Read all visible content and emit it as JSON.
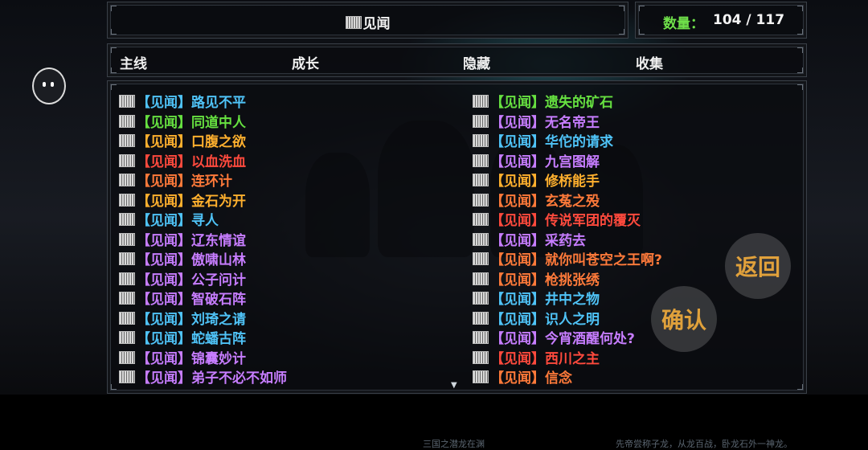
{
  "header": {
    "title": "见闻",
    "count_label": "数量：",
    "count_value": "104 / 117"
  },
  "tabs": [
    {
      "label": "主线"
    },
    {
      "label": "成长"
    },
    {
      "label": "隐藏"
    },
    {
      "label": "收集"
    }
  ],
  "left_column": [
    {
      "tag": "【见闻】",
      "name": "路见不平",
      "color": "#4fc3f7"
    },
    {
      "tag": "【见闻】",
      "name": "同道中人",
      "color": "#66e040"
    },
    {
      "tag": "【见闻】",
      "name": "口腹之欲",
      "color": "#ffb02e"
    },
    {
      "tag": "【见闻】",
      "name": "以血洗血",
      "color": "#ff4a3d"
    },
    {
      "tag": "【见闻】",
      "name": "连环计",
      "color": "#ff7a3a"
    },
    {
      "tag": "【见闻】",
      "name": "金石为开",
      "color": "#ffb02e"
    },
    {
      "tag": "【见闻】",
      "name": "寻人",
      "color": "#4fc3f7"
    },
    {
      "tag": "【见闻】",
      "name": "辽东情谊",
      "color": "#c77dff"
    },
    {
      "tag": "【见闻】",
      "name": "傲啸山林",
      "color": "#c77dff"
    },
    {
      "tag": "【见闻】",
      "name": "公子问计",
      "color": "#c77dff"
    },
    {
      "tag": "【见闻】",
      "name": "智破石阵",
      "color": "#c77dff"
    },
    {
      "tag": "【见闻】",
      "name": "刘琦之请",
      "color": "#4fc3f7"
    },
    {
      "tag": "【见闻】",
      "name": "蛇蟠古阵",
      "color": "#4fc3f7"
    },
    {
      "tag": "【见闻】",
      "name": "锦囊妙计",
      "color": "#c77dff"
    },
    {
      "tag": "【见闻】",
      "name": "弟子不必不如师",
      "color": "#c77dff"
    }
  ],
  "right_column": [
    {
      "tag": "【见闻】",
      "name": "遗失的矿石",
      "color": "#66e040"
    },
    {
      "tag": "【见闻】",
      "name": "无名帝王",
      "color": "#c77dff"
    },
    {
      "tag": "【见闻】",
      "name": "华佗的请求",
      "color": "#4fc3f7"
    },
    {
      "tag": "【见闻】",
      "name": "九宫图解",
      "color": "#c77dff"
    },
    {
      "tag": "【见闻】",
      "name": "修桥能手",
      "color": "#ffb02e"
    },
    {
      "tag": "【见闻】",
      "name": "玄菟之殁",
      "color": "#ff7a3a"
    },
    {
      "tag": "【见闻】",
      "name": "传说军团的覆灭",
      "color": "#ff4a3d"
    },
    {
      "tag": "【见闻】",
      "name": "采药去",
      "color": "#c77dff"
    },
    {
      "tag": "【见闻】",
      "name": "就你叫苍空之王啊?",
      "color": "#ff7a3a"
    },
    {
      "tag": "【见闻】",
      "name": "枪挑张绣",
      "color": "#ff7a3a"
    },
    {
      "tag": "【见闻】",
      "name": "井中之物",
      "color": "#4fc3f7"
    },
    {
      "tag": "【见闻】",
      "name": "识人之明",
      "color": "#4fc3f7"
    },
    {
      "tag": "【见闻】",
      "name": "今宵酒醒何处?",
      "color": "#c77dff"
    },
    {
      "tag": "【见闻】",
      "name": "西川之主",
      "color": "#ff4a3d"
    },
    {
      "tag": "【见闻】",
      "name": "信念",
      "color": "#ff7a3a"
    }
  ],
  "buttons": {
    "return": "返回",
    "confirm": "确认"
  },
  "footer": {
    "watermark_left": "三国之潜龙在渊",
    "watermark_right": "先帝尝称子龙，从龙百战，卧龙石外一神龙。"
  },
  "icons": {
    "entry_icon": "book-icon",
    "scroll_indicator": "chevron-down-icon"
  }
}
